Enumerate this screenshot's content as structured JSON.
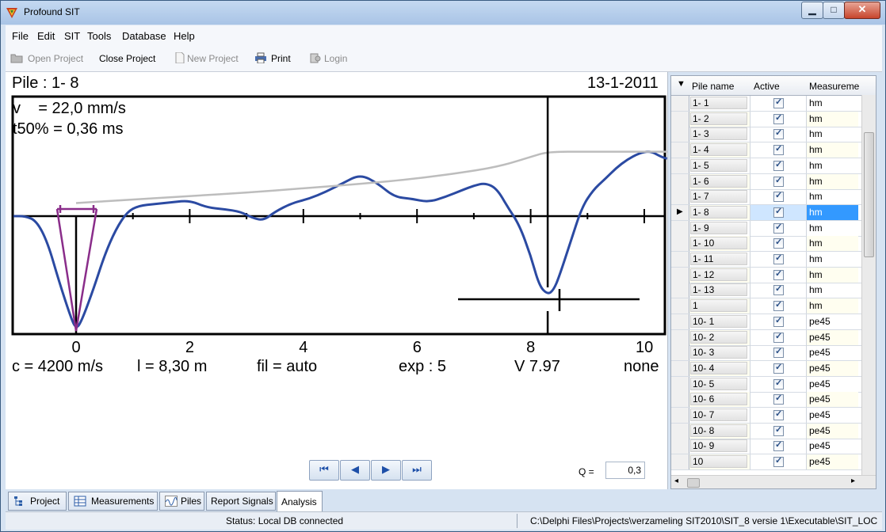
{
  "window": {
    "title": "Profound SIT"
  },
  "menu": [
    "File",
    "Edit",
    "SIT",
    "Tools",
    "Database",
    "Help"
  ],
  "toolbar": {
    "open_project": "Open Project",
    "close_project": "Close Project",
    "new_project": "New Project",
    "print": "Print",
    "login": "Login"
  },
  "chart": {
    "pile_label": "Pile : 1- 8",
    "date": "13-1-2011",
    "velocity": "v    = 22,0 mm/s",
    "t50": "t50% = 0,36 ms",
    "c": "c = 4200 m/s",
    "l": "l = 8,30 m",
    "fil": "fil = auto",
    "exp": "exp : 5",
    "version": "V 7.97",
    "none": "none"
  },
  "chart_data": {
    "type": "line",
    "xlabel": "",
    "ylabel": "",
    "xlim": [
      -1.1,
      10.4
    ],
    "x_ticks": [
      "0",
      "2",
      "4",
      "6",
      "8",
      "10"
    ],
    "x_tick_values": [
      0,
      2,
      4,
      6,
      8,
      10
    ],
    "series": [
      {
        "color": "#2b4aa2",
        "x": [
          -1.1,
          -0.9,
          -0.7,
          -0.5,
          -0.3,
          -0.1,
          0.0,
          0.1,
          0.3,
          0.5,
          0.7,
          0.9,
          1.1,
          1.4,
          1.7,
          2.0,
          2.3,
          2.6,
          2.9,
          3.1,
          3.3,
          3.5,
          3.8,
          4.1,
          4.4,
          4.7,
          5.0,
          5.3,
          5.6,
          5.9,
          6.2,
          6.5,
          6.8,
          7.0,
          7.2,
          7.4,
          7.6,
          7.8,
          8.0,
          8.15,
          8.3,
          8.4,
          8.5,
          8.7,
          8.9,
          9.1,
          9.3,
          9.5,
          9.7,
          9.9,
          10.1,
          10.3,
          10.4
        ],
        "y": [
          0.0,
          0.0,
          -0.05,
          -0.3,
          -0.75,
          -1.15,
          -1.3,
          -1.2,
          -0.85,
          -0.45,
          -0.15,
          0.05,
          0.12,
          0.14,
          0.16,
          0.18,
          0.1,
          0.08,
          0.05,
          -0.02,
          -0.05,
          0.05,
          0.15,
          0.2,
          0.28,
          0.38,
          0.48,
          0.38,
          0.22,
          0.2,
          0.16,
          0.22,
          0.3,
          0.35,
          0.38,
          0.32,
          0.1,
          -0.1,
          -0.45,
          -0.8,
          -0.9,
          -0.85,
          -0.7,
          -0.3,
          0.1,
          0.3,
          0.42,
          0.55,
          0.65,
          0.72,
          0.75,
          0.68,
          0.66
        ]
      },
      {
        "color": "#bdbdbd",
        "x": [
          0.0,
          1.0,
          2.0,
          3.0,
          4.0,
          5.0,
          6.0,
          7.0,
          7.5,
          8.0,
          8.3,
          9.0,
          10.0,
          10.4
        ],
        "y": [
          0.15,
          0.19,
          0.23,
          0.27,
          0.32,
          0.37,
          0.43,
          0.52,
          0.58,
          0.68,
          0.74,
          0.74,
          0.74,
          0.74
        ]
      }
    ],
    "markers": {
      "pile_top_x": 0.0,
      "pile_toe_x": 8.3,
      "grid": false,
      "legend": "none"
    }
  },
  "nav": {
    "first": "⏮",
    "prev": "◀",
    "next": "▶",
    "last": "⏭"
  },
  "q": {
    "label": "Q =",
    "value": "0,3"
  },
  "grid": {
    "headers": [
      "Pile name",
      "Active",
      "Measuremen"
    ],
    "rows": [
      {
        "name": "1- 1",
        "meas": "hm"
      },
      {
        "name": "1- 2",
        "meas": "hm"
      },
      {
        "name": "1- 3",
        "meas": "hm"
      },
      {
        "name": "1- 4",
        "meas": "hm"
      },
      {
        "name": "1- 5",
        "meas": "hm"
      },
      {
        "name": "1- 6",
        "meas": "hm"
      },
      {
        "name": "1- 7",
        "meas": "hm"
      },
      {
        "name": "1- 8",
        "meas": "hm",
        "selected": true
      },
      {
        "name": "1- 9",
        "meas": "hm"
      },
      {
        "name": "1- 10",
        "meas": "hm"
      },
      {
        "name": "1- 11",
        "meas": "hm"
      },
      {
        "name": "1- 12",
        "meas": "hm"
      },
      {
        "name": "1- 13",
        "meas": "hm"
      },
      {
        "name": "1",
        "meas": "hm"
      },
      {
        "name": "10- 1",
        "meas": "pe45"
      },
      {
        "name": "10- 2",
        "meas": "pe45"
      },
      {
        "name": "10- 3",
        "meas": "pe45"
      },
      {
        "name": "10- 4",
        "meas": "pe45"
      },
      {
        "name": "10- 5",
        "meas": "pe45"
      },
      {
        "name": "10- 6",
        "meas": "pe45"
      },
      {
        "name": "10- 7",
        "meas": "pe45"
      },
      {
        "name": "10- 8",
        "meas": "pe45"
      },
      {
        "name": "10- 9",
        "meas": "pe45"
      },
      {
        "name": "10",
        "meas": "pe45"
      }
    ]
  },
  "tabs": [
    "Project",
    "Measurements",
    "Piles",
    "Report Signals",
    "Analysis"
  ],
  "status": {
    "left": "Status: Local DB connected",
    "right": "C:\\Delphi Files\\Projects\\verzameling SIT2010\\SIT_8 versie 1\\Executable\\SIT_LOC"
  },
  "colors": {
    "signal": "#2b4aa2",
    "upper_trend": "#bdbdbd",
    "pick_marker": "#8a2d8a",
    "selection": "#3399ff"
  }
}
